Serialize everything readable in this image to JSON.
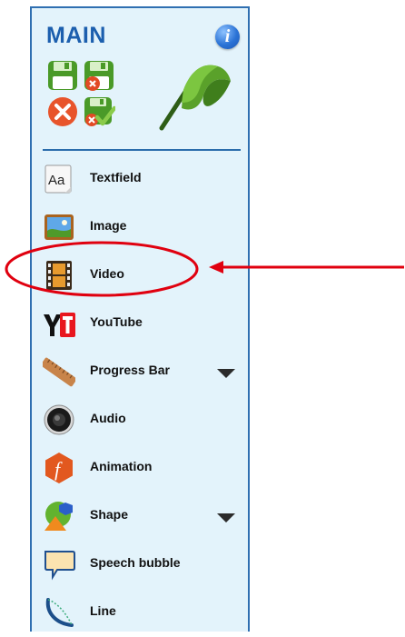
{
  "panel": {
    "title": "MAIN",
    "info_icon": "info-icon",
    "info_glyph": "i",
    "toolbar": [
      {
        "name": "save-button",
        "icon": "floppy-disk-icon",
        "color": "#4d9e2a"
      },
      {
        "name": "save-close-button",
        "icon": "floppy-disk-close-icon",
        "color": "#4d9e2a"
      },
      {
        "name": "cancel-button",
        "icon": "close-circle-icon",
        "color": "#e8542b"
      },
      {
        "name": "save-confirm-button",
        "icon": "floppy-disk-check-icon",
        "color": "#4d9e2a"
      }
    ],
    "flag_icon": "green-flag-icon"
  },
  "tools": [
    {
      "label": "Textfield",
      "icon": "text-aa-icon",
      "has_dropdown": false
    },
    {
      "label": "Image",
      "icon": "image-icon",
      "has_dropdown": false
    },
    {
      "label": "Video",
      "icon": "film-strip-icon",
      "has_dropdown": false
    },
    {
      "label": "YouTube",
      "icon": "youtube-icon",
      "has_dropdown": false
    },
    {
      "label": "Progress Bar",
      "icon": "ruler-icon",
      "has_dropdown": true
    },
    {
      "label": "Audio",
      "icon": "speaker-icon",
      "has_dropdown": false
    },
    {
      "label": "Animation",
      "icon": "animation-f-icon",
      "has_dropdown": false
    },
    {
      "label": "Shape",
      "icon": "shapes-icon",
      "has_dropdown": true
    },
    {
      "label": "Speech bubble",
      "icon": "speech-bubble-icon",
      "has_dropdown": false
    },
    {
      "label": "Line",
      "icon": "curved-line-icon",
      "has_dropdown": false
    }
  ],
  "colors": {
    "panel_bg": "#e3f3fb",
    "panel_border": "#2f6fb1",
    "title": "#1c5fae",
    "annotation": "#e0000f"
  }
}
